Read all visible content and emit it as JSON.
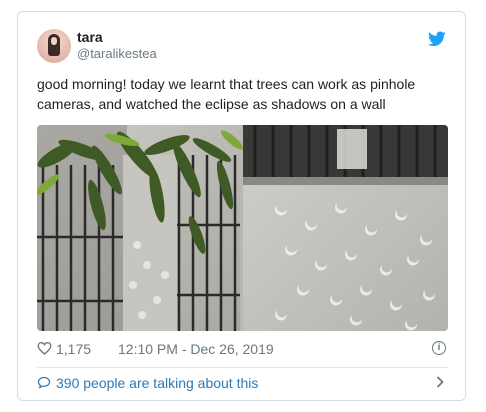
{
  "tweet": {
    "author_name": "tara",
    "author_handle": "@taralikestea",
    "text": "good morning! today we learnt that trees can work as pinhole cameras, and watched the eclipse as shadows on a wall",
    "likes": "1,175",
    "timestamp": "12:10 PM - Dec 26, 2019",
    "conversation_label": "390 people are talking about this"
  },
  "icons": {
    "brand": "twitter-bird-icon",
    "like": "heart-icon",
    "info": "info-icon",
    "conversation": "speech-bubble-icon",
    "more": "chevron-right-icon"
  },
  "colors": {
    "twitter_blue": "#1da1f2",
    "link_blue": "#2b7bb9",
    "secondary_text": "#697882",
    "border": "#d5dce1"
  }
}
